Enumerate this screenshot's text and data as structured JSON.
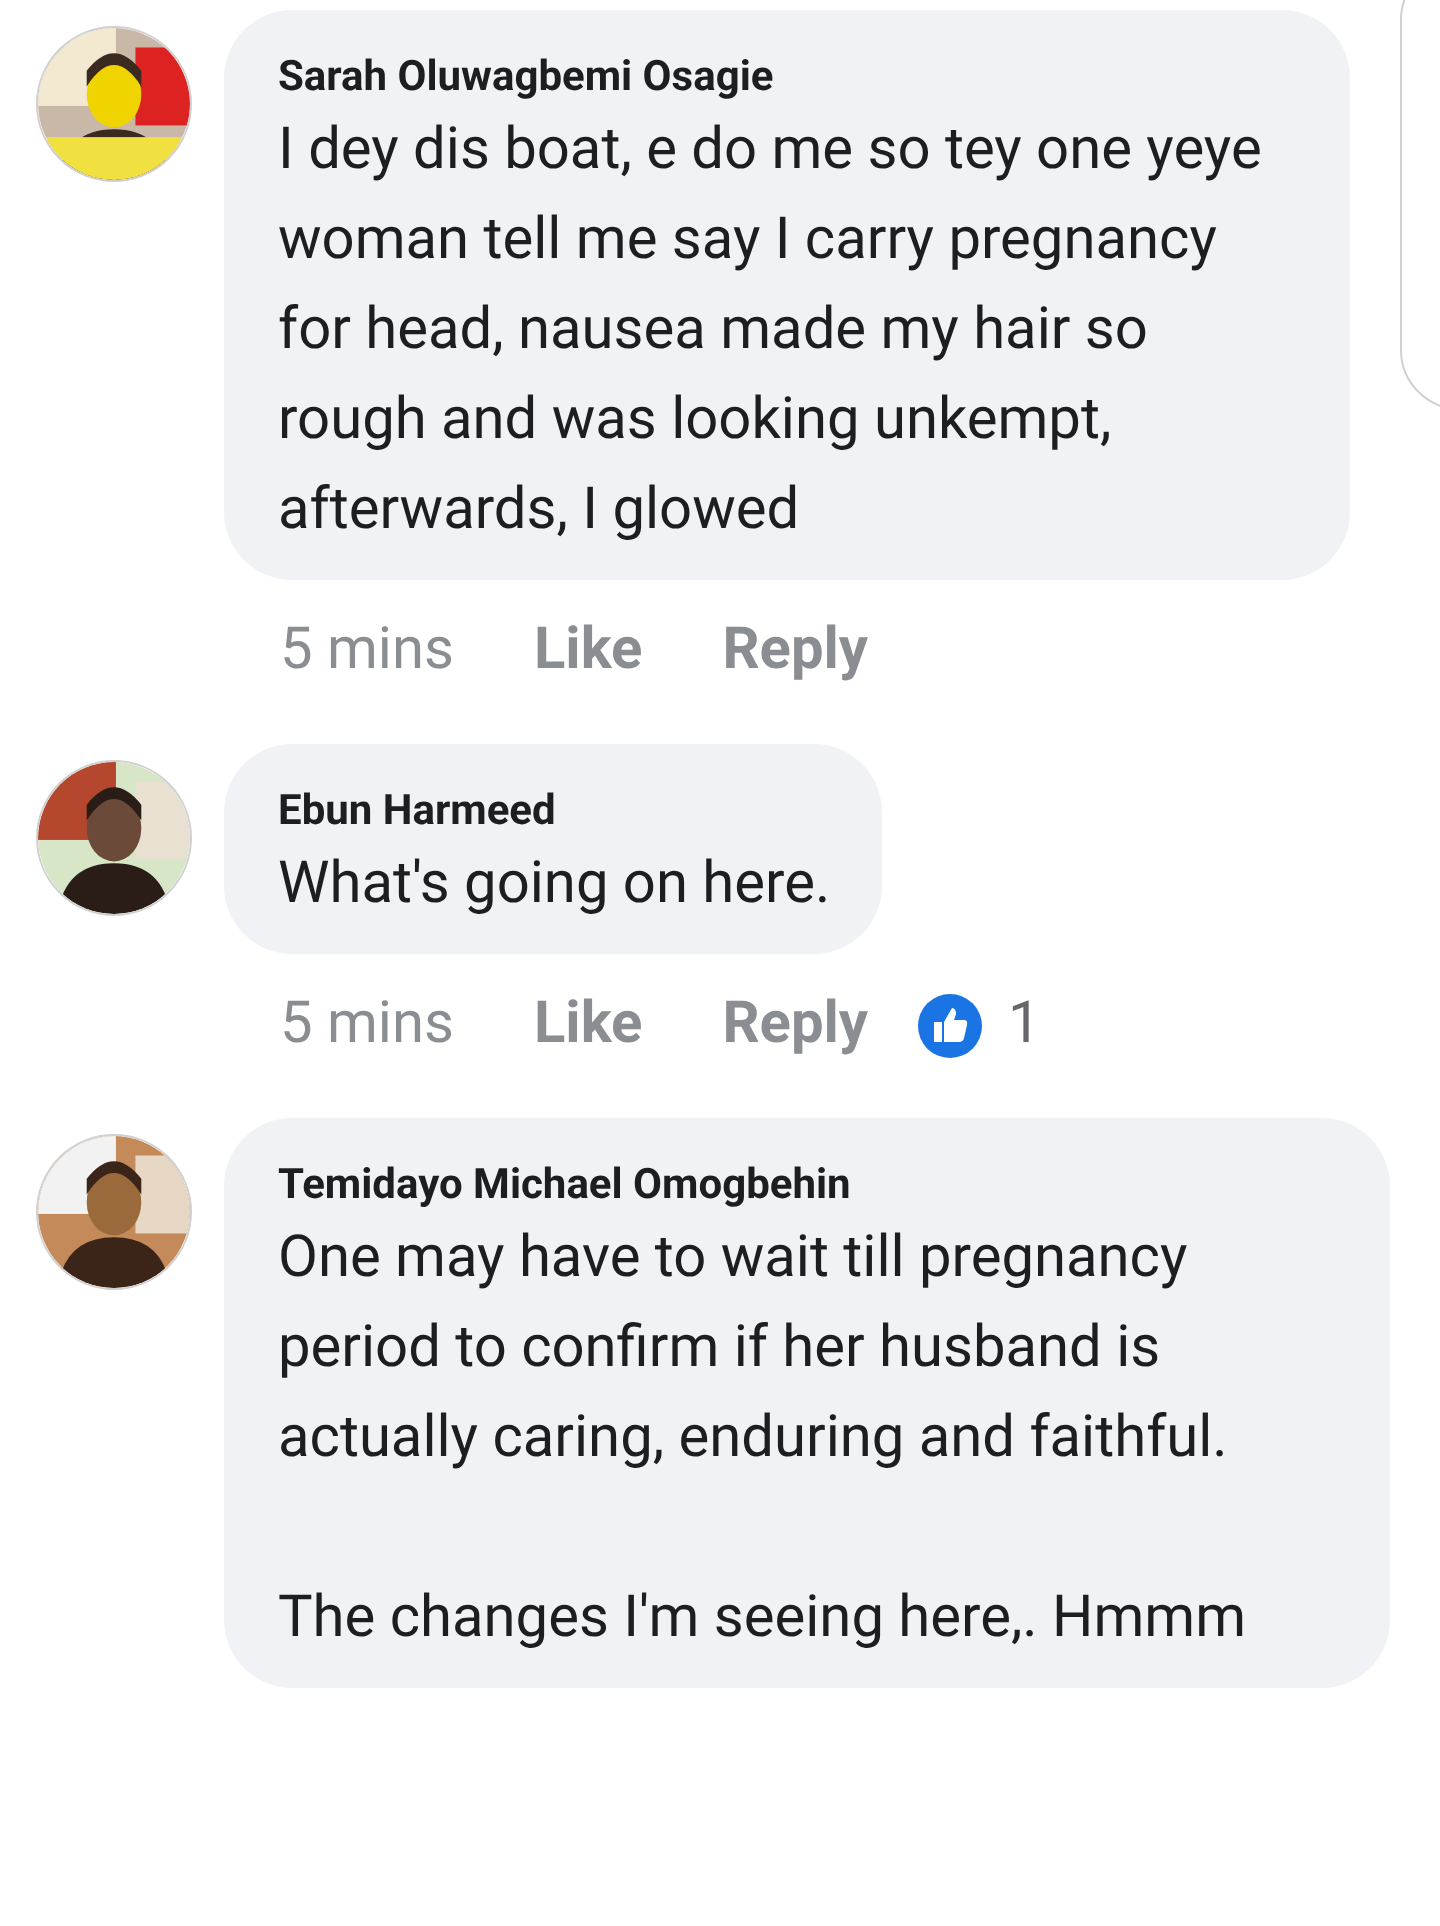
{
  "comments": [
    {
      "author": "Sarah Oluwagbemi Osagie",
      "paragraphs": [
        "I dey dis boat, e do me so tey one yeye woman tell me say I carry pregnancy for head, nausea made my hair so rough and was looking unkempt, afterwards, I glowed"
      ],
      "time": "5 mins",
      "like": "Like",
      "reply": "Reply",
      "avatar": {
        "kind": "picture"
      }
    },
    {
      "author": "Ebun Harmeed",
      "paragraphs": [
        "What's going on here."
      ],
      "time": "5 mins",
      "like": "Like",
      "reply": "Reply",
      "reaction_count": "1",
      "avatar": {
        "kind": "picture"
      }
    },
    {
      "author": "Temidayo Michael Omogbehin",
      "paragraphs": [
        "One may have to wait till pregnancy period to confirm if her husband is actually caring, enduring and faithful.",
        "The changes I'm seeing here,. Hmmm"
      ],
      "avatar": {
        "kind": "picture"
      }
    }
  ]
}
